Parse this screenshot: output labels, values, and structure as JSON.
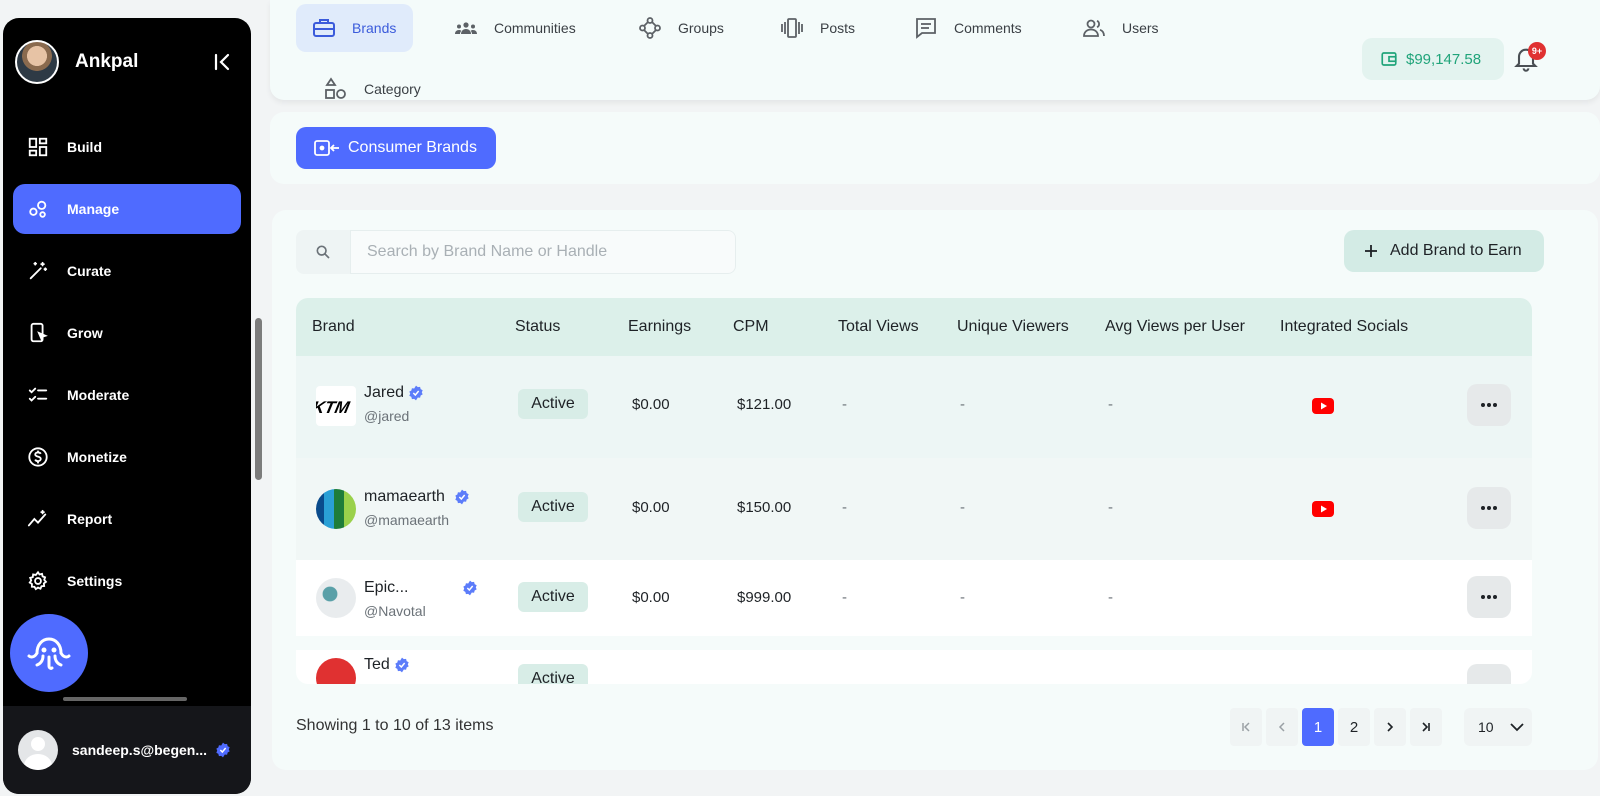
{
  "sidebar": {
    "brand_name": "Ankpal",
    "items": [
      {
        "label": "Build",
        "icon": "grid-icon",
        "active": false
      },
      {
        "label": "Manage",
        "icon": "manage-icon",
        "active": true
      },
      {
        "label": "Curate",
        "icon": "magic-wand-icon",
        "active": false
      },
      {
        "label": "Grow",
        "icon": "phone-cursor-icon",
        "active": false
      },
      {
        "label": "Moderate",
        "icon": "checklist-icon",
        "active": false
      },
      {
        "label": "Monetize",
        "icon": "dollar-coin-icon",
        "active": false
      },
      {
        "label": "Report",
        "icon": "trend-icon",
        "active": false
      },
      {
        "label": "Settings",
        "icon": "gear-icon",
        "active": false
      }
    ],
    "user_email": "sandeep.s@begen..."
  },
  "tabs": [
    {
      "label": "Brands",
      "icon": "briefcase-icon",
      "active": true
    },
    {
      "label": "Communities",
      "icon": "people-group-icon",
      "active": false
    },
    {
      "label": "Groups",
      "icon": "groups-icon",
      "active": false
    },
    {
      "label": "Posts",
      "icon": "posts-icon",
      "active": false
    },
    {
      "label": "Comments",
      "icon": "comment-icon",
      "active": false
    },
    {
      "label": "Users",
      "icon": "users-icon",
      "active": false
    },
    {
      "label": "Category",
      "icon": "shapes-icon",
      "active": false
    }
  ],
  "header": {
    "wallet_balance": "$99,147.58",
    "notification_badge": "9+"
  },
  "subnav": {
    "consumer_brands_label": "Consumer Brands"
  },
  "search": {
    "placeholder": "Search by Brand Name or Handle",
    "value": ""
  },
  "add_brand_label": "Add Brand to Earn",
  "table": {
    "columns": [
      "Brand",
      "Status",
      "Earnings",
      "CPM",
      "Total Views",
      "Unique Viewers",
      "Avg Views per User",
      "Integrated Socials"
    ],
    "rows": [
      {
        "name": "Jared",
        "handle": "@jared",
        "status": "Active",
        "earnings": "$0.00",
        "cpm": "$121.00",
        "total_views": "-",
        "unique_viewers": "-",
        "avg_views": "-",
        "socials": "youtube"
      },
      {
        "name": "mamaearth",
        "handle": "@mamaearth",
        "status": "Active",
        "earnings": "$0.00",
        "cpm": "$150.00",
        "total_views": "-",
        "unique_viewers": "-",
        "avg_views": "-",
        "socials": "youtube"
      },
      {
        "name": "Epic...",
        "handle": "@Navotal",
        "status": "Active",
        "earnings": "$0.00",
        "cpm": "$999.00",
        "total_views": "-",
        "unique_viewers": "-",
        "avg_views": "-",
        "socials": ""
      },
      {
        "name": "Ted",
        "handle": "",
        "status": "Active",
        "earnings": "",
        "cpm": "",
        "total_views": "",
        "unique_viewers": "",
        "avg_views": "",
        "socials": ""
      }
    ]
  },
  "footer": {
    "showing_text": "Showing 1 to 10 of 13 items",
    "pages": [
      "1",
      "2"
    ],
    "current_page": "1",
    "page_size": "10"
  },
  "colors": {
    "accent": "#4f6bff",
    "sidebar_bg": "#000000",
    "wallet_text": "#20a47a",
    "badge": "#e03131",
    "youtube": "#ff0000"
  }
}
